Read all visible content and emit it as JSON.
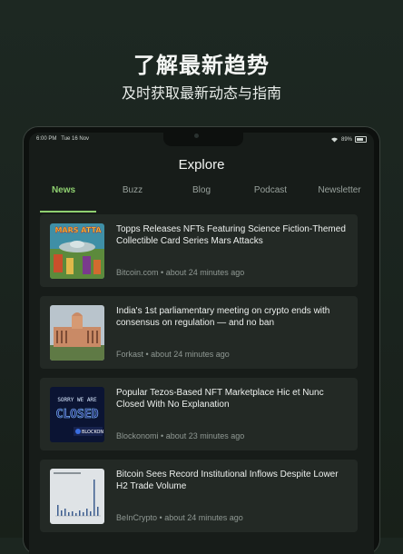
{
  "hero": {
    "title": "了解最新趋势",
    "subtitle": "及时获取最新动态与指南"
  },
  "status_bar": {
    "time": "6:00 PM",
    "date": "Tue 16 Nov",
    "battery": "89%"
  },
  "header": {
    "title": "Explore"
  },
  "tabs": [
    {
      "label": "News",
      "active": true
    },
    {
      "label": "Buzz"
    },
    {
      "label": "Blog"
    },
    {
      "label": "Podcast"
    },
    {
      "label": "Newsletter"
    }
  ],
  "articles": [
    {
      "title": "Topps Releases NFTs Featuring Science Fiction-Themed Collectible Card Series Mars Attacks",
      "source": "Bitcoin.com",
      "time": "about 24 minutes ago",
      "thumb_text": "MARS ATTA"
    },
    {
      "title": "India's 1st parliamentary meeting on crypto ends with consensus on regulation — and no ban",
      "source": "Forkast",
      "time": "about 24 minutes ago"
    },
    {
      "title": "Popular Tezos-Based NFT Marketplace Hic et Nunc Closed With No Explanation",
      "source": "Blockonomi",
      "time": "about 23 minutes ago",
      "thumb_text_top": "SORRY WE ARE",
      "thumb_text_big": "CLOSED",
      "thumb_brand": "BLOCKON"
    },
    {
      "title": "Bitcoin Sees Record Institutional Inflows Despite Lower H2 Trade Volume",
      "source": "BeInCrypto",
      "time": "about 24 minutes ago"
    }
  ],
  "colors": {
    "accent": "#8fd070",
    "background": "#1c2620",
    "card": "#232925"
  }
}
